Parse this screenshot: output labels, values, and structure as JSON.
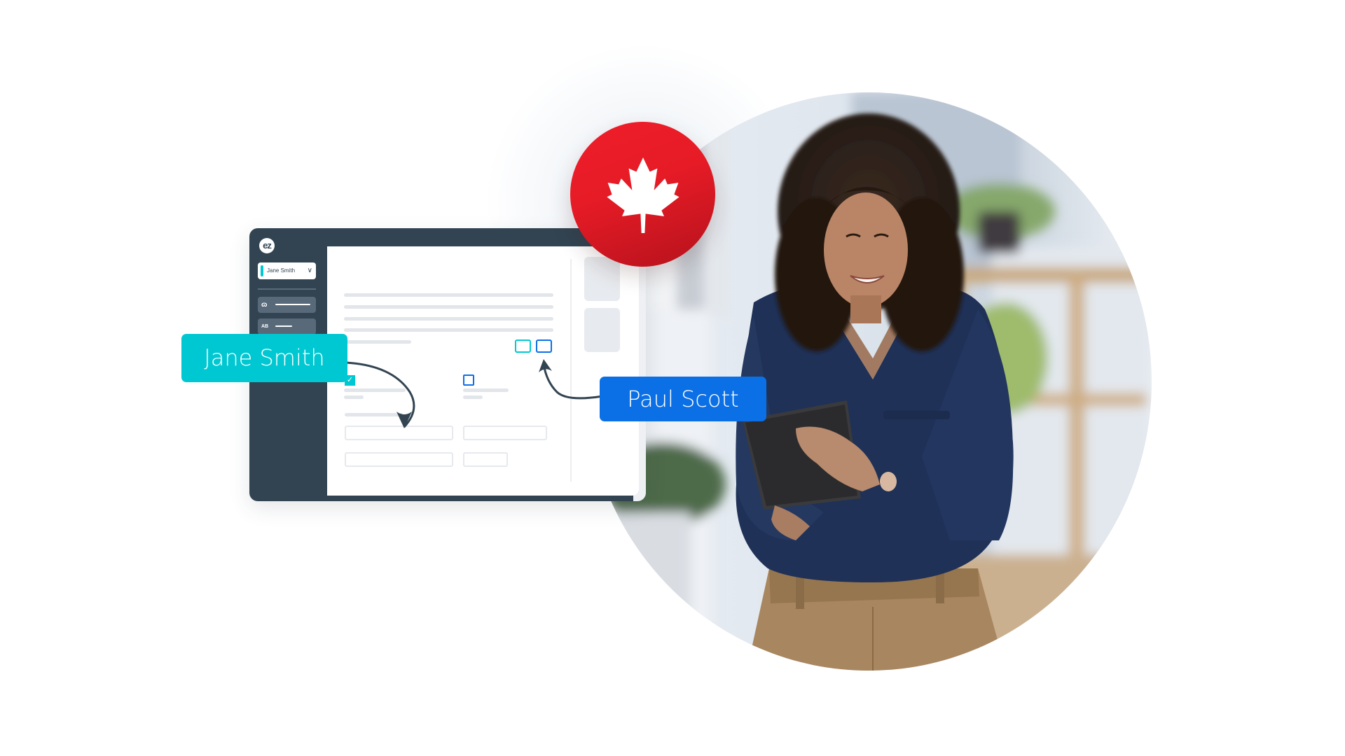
{
  "app": {
    "logo_text": "ez",
    "signer_dropdown": {
      "selected": "Jane Smith"
    },
    "sidebar_tools": [
      {
        "icon": "signature-icon",
        "glyph": "ɷ"
      },
      {
        "icon": "initials-icon",
        "glyph": "AB"
      }
    ]
  },
  "labels": {
    "signer_one": "Jane Smith",
    "signer_two": "Paul Scott"
  },
  "badge": {
    "icon": "maple-leaf-icon",
    "meaning": "Canada"
  },
  "colors": {
    "signer_one": "#00c8d2",
    "signer_two": "#0b70e6",
    "sidebar": "#324452",
    "badge_red": "#e51b26"
  },
  "form": {
    "checkbox_one_checked": true,
    "checkbox_two_checked": false
  }
}
